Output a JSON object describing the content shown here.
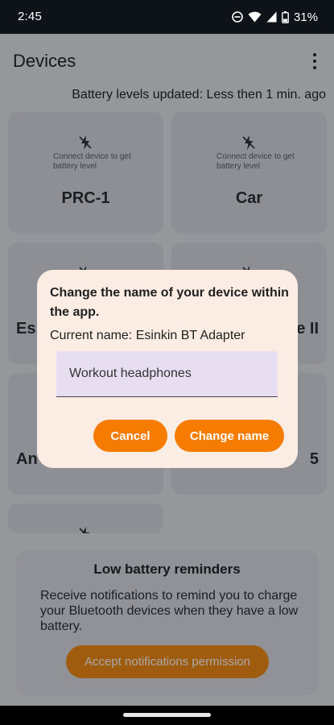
{
  "status_bar": {
    "time": "2:45",
    "battery_percent": "31%",
    "icons": [
      "do-not-disturb-icon",
      "wifi-icon",
      "signal-icon",
      "battery-icon"
    ]
  },
  "header": {
    "title": "Devices",
    "menu_icon": "more-vert-icon"
  },
  "battery_updated": "Battery levels updated: Less then 1 min. ago",
  "devices": [
    {
      "name": "PRC-1",
      "hint": "Connect device to get battery level"
    },
    {
      "name": "Car",
      "hint": "Connect device to get battery level"
    },
    {
      "name": "Esi",
      "hint": ""
    },
    {
      "name": "e II",
      "hint": ""
    },
    {
      "name": "An",
      "hint": ""
    },
    {
      "name": "5",
      "hint": ""
    },
    {
      "name": "",
      "hint": ""
    }
  ],
  "reminder": {
    "title": "Low battery reminders",
    "text": "Receive notifications to remind you to charge your Bluetooth devices when they have a low battery.",
    "button_label": "Accept notifications permission"
  },
  "dialog": {
    "title": "Change the name of your device within the app.",
    "current_name": "Current name: Esinkin BT Adapter",
    "input_value": "Workout headphones",
    "cancel_label": "Cancel",
    "confirm_label": "Change name"
  },
  "colors": {
    "accent": "#f57c00",
    "dialog_bg": "#fcede4",
    "field_bg": "#e7def1"
  }
}
